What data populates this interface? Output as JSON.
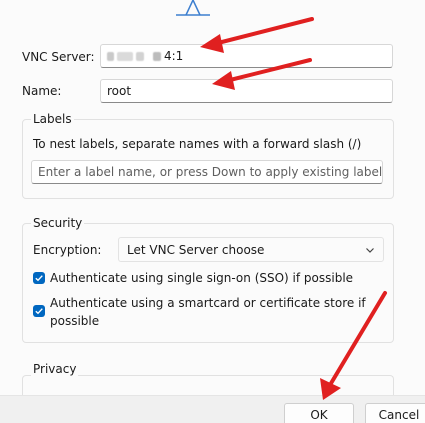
{
  "vnc_server": {
    "label": "VNC Server:",
    "value_suffix": "4:1"
  },
  "name": {
    "label": "Name:",
    "value": "root"
  },
  "labels_group": {
    "title": "Labels",
    "hint": "To nest labels, separate names with a forward slash (/)",
    "placeholder": "Enter a label name, or press Down to apply existing labels"
  },
  "security_group": {
    "title": "Security",
    "encryption_label": "Encryption:",
    "encryption_value": "Let VNC Server choose",
    "sso_checkbox": {
      "label": "Authenticate using single sign-on (SSO) if possible",
      "checked": true
    },
    "smartcard_checkbox": {
      "label_line1": "Authenticate using a smartcard or certificate store if",
      "label_line2": "possible",
      "checked": true
    }
  },
  "privacy_group": {
    "title": "Privacy"
  },
  "footer": {
    "ok_label": "OK",
    "cancel_label": "Cancel"
  },
  "annotation_color": "#e02020",
  "accent_color": "#0067c0",
  "icons": [
    "top-graphic-icon",
    "chevron-down-icon",
    "checkmark-icon",
    "red-arrow-icon"
  ]
}
